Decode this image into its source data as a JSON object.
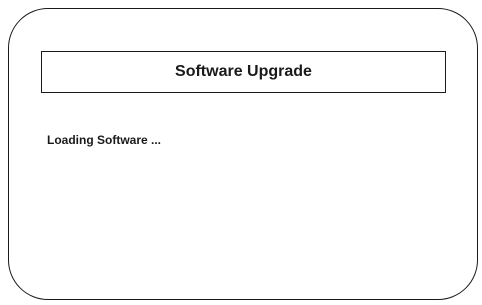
{
  "dialog": {
    "title": "Software Upgrade",
    "status_text": "Loading Software ..."
  }
}
